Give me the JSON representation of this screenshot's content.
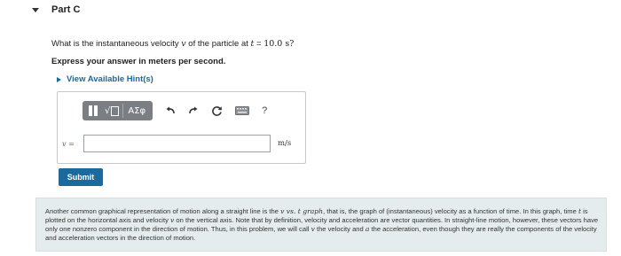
{
  "part": {
    "title": "Part C"
  },
  "question": {
    "prefix": "What is the instantaneous velocity ",
    "var": "v",
    "middle": " of the particle at ",
    "t_var": "t",
    "equals": " = ",
    "value": "10.0 s?",
    "instruction": "Express your answer in meters per second."
  },
  "hints": {
    "label": "View Available Hint(s)"
  },
  "toolbar": {
    "greek_label": "ΑΣφ",
    "help_label": "?",
    "icons": [
      "matrix-icon",
      "sqrt-icon",
      "greek-symbols-icon",
      "undo-icon",
      "redo-icon",
      "reset-icon",
      "keyboard-icon",
      "help-icon"
    ]
  },
  "answer": {
    "var_label": "v",
    "equals": " =",
    "value": "",
    "unit": "m/s"
  },
  "submit": {
    "label": "Submit"
  },
  "info": {
    "p1": "Another common graphical representation of motion along a straight line is the ",
    "p1_italic": "v vs. t graph",
    "p2": ", that is, the graph of (instantaneous) velocity as a function of time. In this graph, time ",
    "p2_t": "t",
    "p3": " is plotted on the horizontal axis and velocity ",
    "p3_v": "v",
    "p4": " on the vertical axis. Note that by definition, velocity and acceleration are vector quantities. In straight-line motion, however, these vectors have only one nonzero component in the direction of motion. Thus, in this problem, we will call ",
    "p4_v": "v",
    "p5": " the velocity and ",
    "p5_a": "a",
    "p6": " the acceleration, even though they are really the components of the velocity and acceleration vectors in the direction of motion."
  },
  "colors": {
    "accent": "#1a6a9e",
    "toolbar_bg": "#7b7f84",
    "info_bg": "#e4eced"
  }
}
